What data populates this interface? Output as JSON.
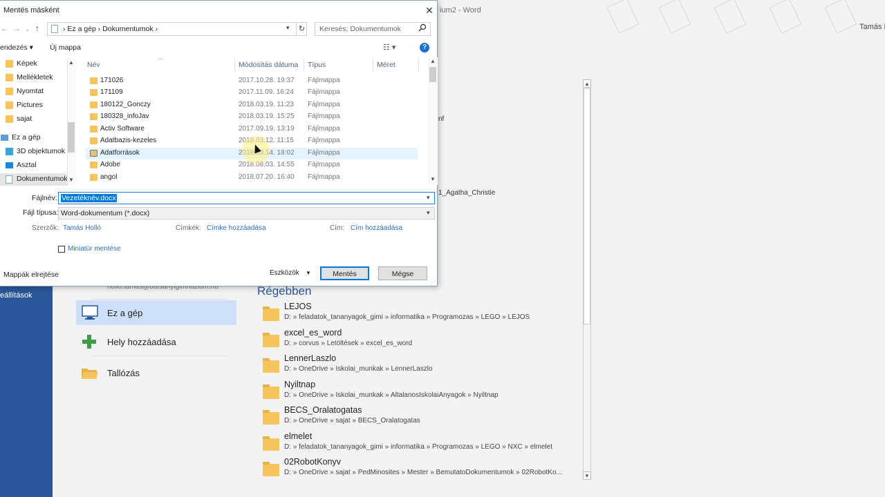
{
  "word": {
    "window_title": "ium2 - Word",
    "user": "Tamás H",
    "nav_settings": "eállítások",
    "email_partial": "hollo.tamas@batsanyigimnazium.hu",
    "bg_partial_1": "nf",
    "bg_partial_2": "1_Agatha_Christie",
    "places": {
      "this_pc": "Ez a gép",
      "add_place": "Hely hozzáadása",
      "browse": "Tallózás"
    },
    "recent_title": "Régebben",
    "recent_folders": [
      {
        "name": "LEJOS",
        "path": "D: » feladatok_tananyagok_gimi » informatika » Programozas » LEGO » LEJOS"
      },
      {
        "name": "excel_es_word",
        "path": "D: » corvus » Letöltések » excel_es_word"
      },
      {
        "name": "LennerLaszlo",
        "path": "D: » OneDrive » Iskolai_munkak » LennerLaszlo"
      },
      {
        "name": "Nyiltnap",
        "path": "D: » OneDrive » Iskolai_munkak » AltalanosIskolaiAnyagok » Nyiltnap"
      },
      {
        "name": "BECS_Oralatogatas",
        "path": "D: » OneDrive » sajat » BECS_Oralatogatas"
      },
      {
        "name": "elmelet",
        "path": "D: » feladatok_tananyagok_gimi » informatika » Programozas » LEGO » NXC » elmelet"
      },
      {
        "name": "02RobotKonyv",
        "path": "D: » OneDrive » sajat » PedMinosites » Mester » BemutatoDokumentumok » 02RobotKo..."
      }
    ]
  },
  "dialog": {
    "title": "Mentés másként",
    "address": {
      "part1": "Ez a gép",
      "sep": "›",
      "part2": "Dokumentumok"
    },
    "search_placeholder": "Keresés: Dokumentumok",
    "toolbar": {
      "organize": "endezés ▾",
      "new_folder": "Új mappa",
      "help": "?"
    },
    "tree": [
      {
        "label": "Képek",
        "kind": "folder"
      },
      {
        "label": "Mellékletek",
        "kind": "folder"
      },
      {
        "label": "Nyomtat",
        "kind": "folder"
      },
      {
        "label": "Pictures",
        "kind": "folder"
      },
      {
        "label": "sajat",
        "kind": "folder"
      },
      {
        "label": "Ez a gép",
        "kind": "pc"
      },
      {
        "label": "3D objektumok",
        "kind": "3d"
      },
      {
        "label": "Asztal",
        "kind": "desktop"
      },
      {
        "label": "Dokumentumok",
        "kind": "docs"
      }
    ],
    "columns": {
      "name": "Név",
      "modified": "Módosítás dátuma",
      "type": "Típus",
      "size": "Méret"
    },
    "files": [
      {
        "name": "171026",
        "date": "2017.10.28. 19:37",
        "type": "Fájlmappa"
      },
      {
        "name": "171109",
        "date": "2017.11.09. 16:24",
        "type": "Fájlmappa"
      },
      {
        "name": "180122_Gonczy",
        "date": "2018.03.19. 11:23",
        "type": "Fájlmappa"
      },
      {
        "name": "180328_infoJav",
        "date": "2018.03.19. 15:25",
        "type": "Fájlmappa"
      },
      {
        "name": "Activ Software",
        "date": "2017.09.19. 13:19",
        "type": "Fájlmappa"
      },
      {
        "name": "Adatbazis-kezeles",
        "date": "2018.03.12. 11:15",
        "type": "Fájlmappa"
      },
      {
        "name": "Adatforrások",
        "date": "2018.03.14. 18:02",
        "type": "Fájlmappa"
      },
      {
        "name": "Adobe",
        "date": "2018.08.03. 14:55",
        "type": "Fájlmappa"
      },
      {
        "name": "angol",
        "date": "2018.07.20. 16:40",
        "type": "Fájlmappa"
      }
    ],
    "filename_label": "Fájlnév:",
    "filename_value": "Vezetéknév.docx",
    "filetype_label": "Fájl típusa:",
    "filetype_value": "Word-dokumentum (*.docx)",
    "meta": {
      "authors_label": "Szerzők:",
      "authors_value": "Tamás Holló",
      "tags_label": "Címkék:",
      "tags_value": "Címke hozzáadása",
      "title_label": "Cím:",
      "title_value": "Cím hozzáadása"
    },
    "thumbnail_label": "Miniatür mentése",
    "hide_folders": "Mappák elrejtése",
    "tools": "Eszközök",
    "save": "Mentés",
    "cancel": "Mégse"
  }
}
